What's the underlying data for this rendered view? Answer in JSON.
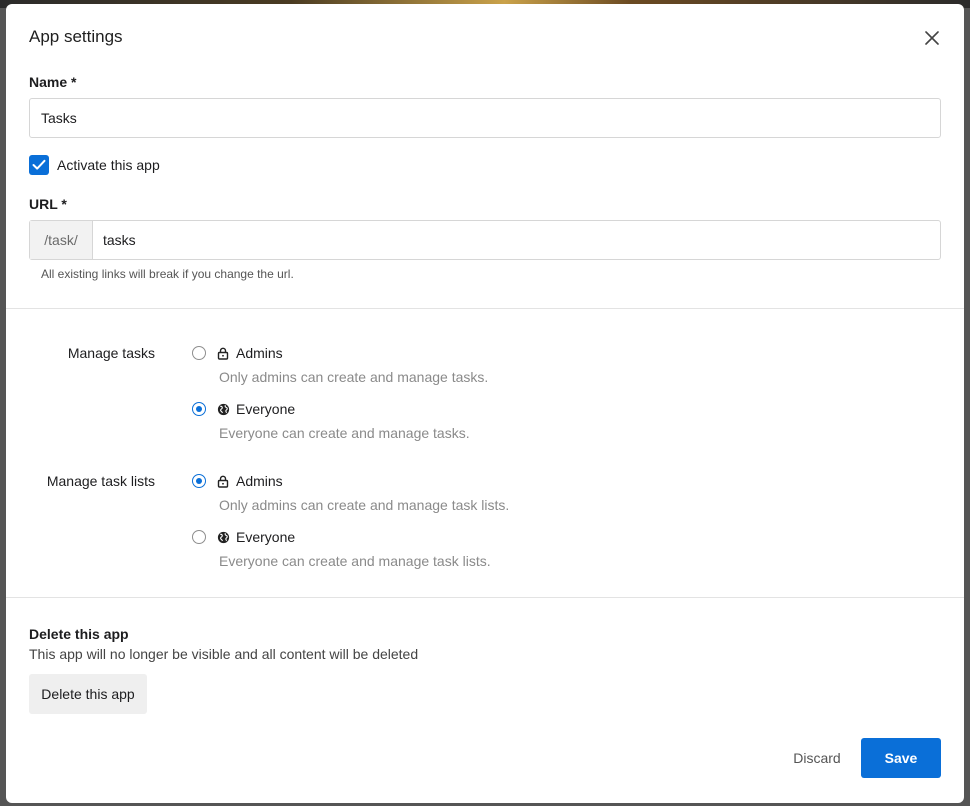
{
  "dialog": {
    "title": "App settings",
    "close_icon": "close-icon"
  },
  "name_field": {
    "label": "Name *",
    "value": "Tasks"
  },
  "activate": {
    "label": "Activate this app",
    "checked": true
  },
  "url_field": {
    "label": "URL *",
    "prefix": "/task/",
    "value": "tasks",
    "help": "All existing links will break if you change the url."
  },
  "permissions": [
    {
      "label": "Manage tasks",
      "options": [
        {
          "icon": "lock-icon",
          "label": "Admins",
          "description": "Only admins can create and manage tasks.",
          "selected": false
        },
        {
          "icon": "globe-icon",
          "label": "Everyone",
          "description": "Everyone can create and manage tasks.",
          "selected": true
        }
      ]
    },
    {
      "label": "Manage task lists",
      "options": [
        {
          "icon": "lock-icon",
          "label": "Admins",
          "description": "Only admins can create and manage task lists.",
          "selected": true
        },
        {
          "icon": "globe-icon",
          "label": "Everyone",
          "description": "Everyone can create and manage task lists.",
          "selected": false
        }
      ]
    }
  ],
  "delete_section": {
    "title": "Delete this app",
    "description": "This app will no longer be visible and all content will be deleted",
    "button_label": "Delete this app"
  },
  "footer": {
    "discard_label": "Discard",
    "save_label": "Save"
  },
  "colors": {
    "accent": "#0a6fd8"
  }
}
